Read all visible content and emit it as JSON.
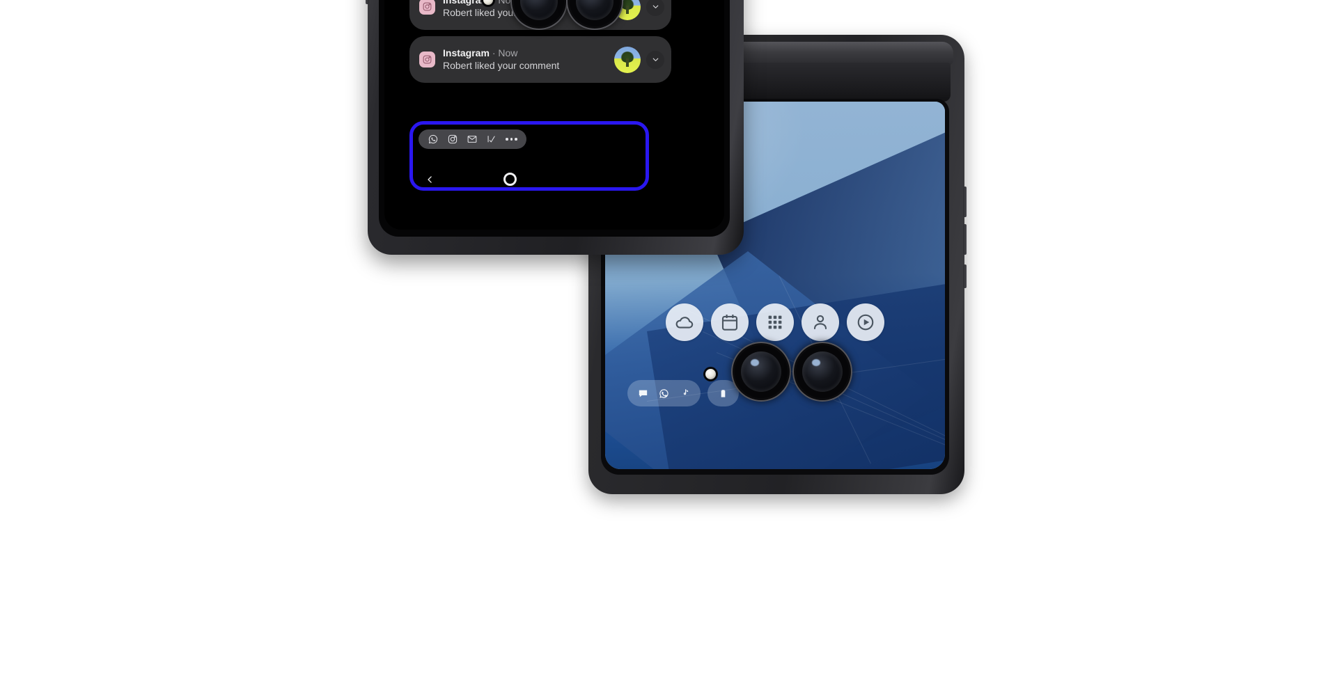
{
  "scene": {
    "description": "Two Motorola Razr flip phones shown closed, displaying cover screens",
    "background_color": "#ffffff",
    "highlight_color": "#2a17f0"
  },
  "front_phone": {
    "device_name": "razr-flip-phone-front",
    "cover_screen": {
      "notifications": [
        {
          "app": "Instagram",
          "separator": "·",
          "time": "Now",
          "message": "Robert liked your comment",
          "app_icon": "instagram-icon",
          "thumbnail": "photo-thumbnail",
          "expand_icon": "chevron-down-icon"
        },
        {
          "app": "Instagram",
          "separator": "·",
          "time": "Now",
          "message": "Robert liked your comment",
          "app_icon": "instagram-icon",
          "thumbnail": "photo-thumbnail",
          "expand_icon": "chevron-down-icon"
        }
      ],
      "app_shortcuts": [
        {
          "name": "whatsapp-icon",
          "label": "WhatsApp"
        },
        {
          "name": "instagram-icon",
          "label": "Instagram"
        },
        {
          "name": "mail-icon",
          "label": "Mail"
        },
        {
          "name": "tasks-icon",
          "label": "Tasks"
        },
        {
          "name": "more-icon",
          "label": "More"
        }
      ],
      "nav_bar": {
        "back": "back-icon",
        "home": "home-icon"
      }
    },
    "camera": {
      "flash": "flash-led",
      "lenses": 2
    }
  },
  "back_phone": {
    "device_name": "razr-flip-phone-back",
    "cover_screen": {
      "wallpaper": "blue-architecture-wallpaper",
      "widgets": [
        {
          "name": "weather-icon",
          "label": "Weather"
        },
        {
          "name": "calendar-icon",
          "label": "Calendar"
        },
        {
          "name": "app-grid-icon",
          "label": "All apps"
        },
        {
          "name": "contacts-icon",
          "label": "Contacts"
        },
        {
          "name": "media-play-icon",
          "label": "Media"
        }
      ],
      "dock": {
        "primary": [
          {
            "name": "messages-icon",
            "label": "Messages"
          },
          {
            "name": "whatsapp-icon",
            "label": "WhatsApp"
          },
          {
            "name": "tiktok-icon",
            "label": "TikTok"
          }
        ],
        "secondary": [
          {
            "name": "battery-icon",
            "label": "Battery"
          }
        ]
      }
    },
    "camera": {
      "flash": "flash-led",
      "lenses": 2
    },
    "side_buttons": [
      "volume-up-button",
      "volume-down-button",
      "power-button"
    ]
  }
}
